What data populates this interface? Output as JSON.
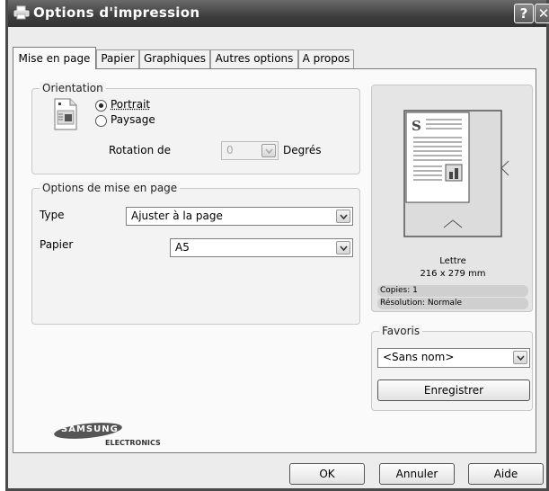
{
  "window": {
    "title": "Options d'impression",
    "help_label": "?",
    "close_label": "✕"
  },
  "tabs": [
    {
      "label": "Mise en page",
      "active": true
    },
    {
      "label": "Papier"
    },
    {
      "label": "Graphiques"
    },
    {
      "label": "Autres options"
    },
    {
      "label": "A propos"
    }
  ],
  "orientation": {
    "legend": "Orientation",
    "portrait_label": "Portrait",
    "paysage_label": "Paysage",
    "selected": "Portrait",
    "rotation_label": "Rotation de",
    "rotation_value": "0",
    "degrees_label": "Degrés"
  },
  "layout_options": {
    "legend": "Options de mise en page",
    "type_label": "Type",
    "type_value": "Ajuster à la page",
    "paper_label": "Papier",
    "paper_value": "A5"
  },
  "preview": {
    "paper_name": "Lettre",
    "paper_size": "216 x 279 mm",
    "copies": "Copies: 1",
    "resolution": "Résolution: Normale",
    "page_letter": "S"
  },
  "favorites": {
    "legend": "Favoris",
    "value": "<Sans nom>",
    "save_label": "Enregistrer"
  },
  "brand": {
    "name": "SAMSUNG",
    "sub": "ELECTRONICS"
  },
  "footer": {
    "ok_label": "OK",
    "cancel_label": "Annuler",
    "help_label": "Aide"
  },
  "icons": [
    "printer-icon",
    "portrait-orientation-icon",
    "chevron-down-icon",
    "help-icon",
    "close-icon"
  ],
  "colors": {
    "titlebar": "#3e3e3e",
    "window": "#ececec",
    "panel": "#fafafa"
  }
}
